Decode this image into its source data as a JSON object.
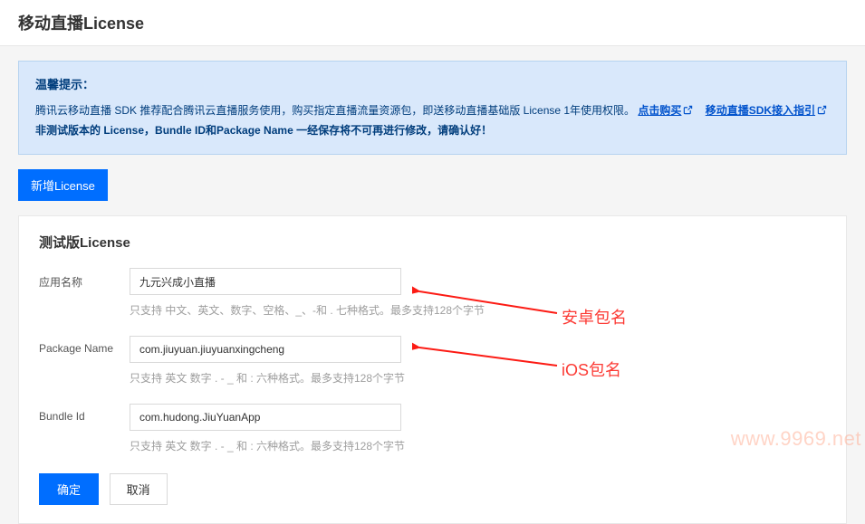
{
  "page": {
    "title": "移动直播License"
  },
  "tip": {
    "title": "温馨提示：",
    "line1_prefix": "腾讯云移动直播 SDK 推荐配合腾讯云直播服务使用，购买指定直播流量资源包，即送移动直播基础版 License 1年使用权限。",
    "link1": "点击购买",
    "link2": "移动直播SDK接入指引",
    "line2": "非测试版本的 License，Bundle ID和Package Name 一经保存将不可再进行修改，请确认好！"
  },
  "buttons": {
    "add": "新增License",
    "ok": "确定",
    "cancel": "取消"
  },
  "form": {
    "title": "测试版License",
    "appName": {
      "label": "应用名称",
      "value": "九元兴成小直播",
      "hint": "只支持 中文、英文、数字、空格、_、-和 . 七种格式。最多支持128个字节"
    },
    "packageName": {
      "label": "Package Name",
      "value": "com.jiuyuan.jiuyuanxingcheng",
      "hint": "只支持 英文 数字 . - _ 和 : 六种格式。最多支持128个字节"
    },
    "bundleId": {
      "label": "Bundle Id",
      "value": "com.hudong.JiuYuanApp",
      "hint": "只支持 英文 数字 . - _ 和 : 六种格式。最多支持128个字节"
    }
  },
  "annotations": {
    "android": "安卓包名",
    "ios": "iOS包名"
  },
  "watermark": "www.9969.net"
}
